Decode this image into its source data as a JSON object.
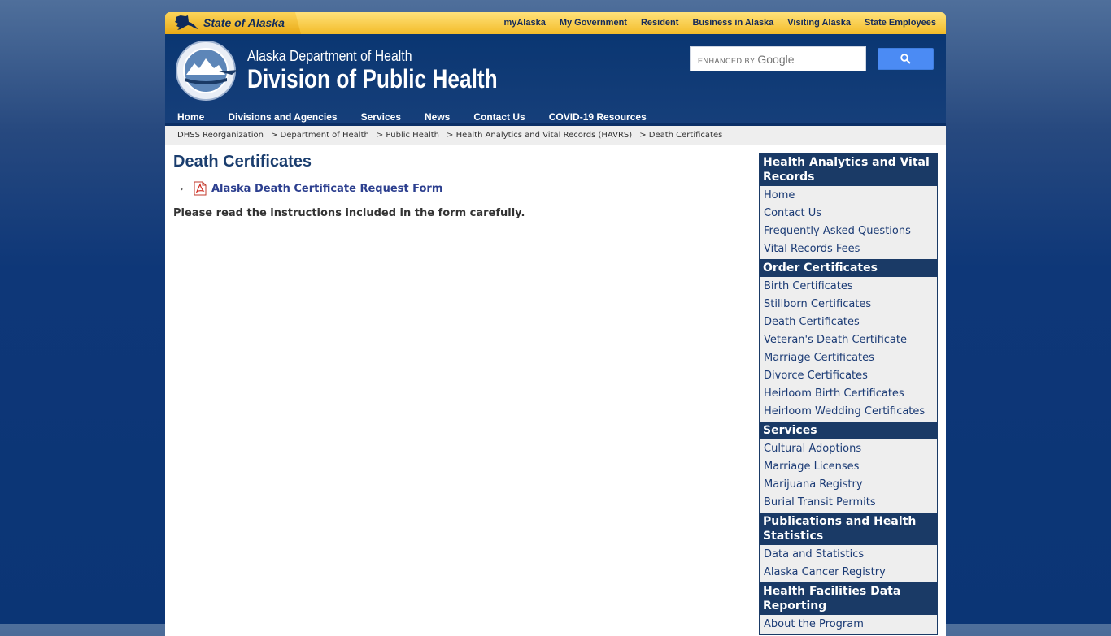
{
  "topbar": {
    "brand": "State of Alaska",
    "links": [
      "myAlaska",
      "My Government",
      "Resident",
      "Business in Alaska",
      "Visiting Alaska",
      "State Employees"
    ]
  },
  "header": {
    "dept": "Alaska Department of Health",
    "division": "Division of Public Health",
    "search_hint_small": "ENHANCED BY",
    "search_hint_brand": "Google"
  },
  "nav": [
    "Home",
    "Divisions and Agencies",
    "Services",
    "News",
    "Contact Us",
    "COVID-19 Resources"
  ],
  "breadcrumb": [
    "DHSS Reorganization",
    "> Department of Health",
    "> Public Health",
    "> Health Analytics and Vital Records (HAVRS)",
    "> Death Certificates"
  ],
  "main": {
    "title": "Death Certificates",
    "link_label": "Alaska Death Certificate Request Form",
    "instructions": "Please read the instructions included in the form carefully."
  },
  "sidebar": [
    {
      "heading": "Health Analytics and Vital Records",
      "items": [
        "Home",
        "Contact Us",
        "Frequently Asked Questions",
        "Vital Records Fees"
      ]
    },
    {
      "heading": "Order Certificates",
      "items": [
        "Birth Certificates",
        "Stillborn Certificates",
        "Death Certificates",
        "Veteran's Death Certificate",
        "Marriage Certificates",
        "Divorce Certificates",
        "Heirloom Birth Certificates",
        "Heirloom Wedding Certificates"
      ]
    },
    {
      "heading": "Services",
      "items": [
        "Cultural Adoptions",
        "Marriage Licenses",
        "Marijuana Registry",
        "Burial Transit Permits"
      ]
    },
    {
      "heading": "Publications and Health Statistics",
      "items": [
        "Data and Statistics",
        "Alaska Cancer Registry"
      ]
    },
    {
      "heading": "Health Facilities Data Reporting",
      "items": [
        "About the Program"
      ]
    }
  ],
  "colors": {
    "accent_yellow": "#f3bc2a",
    "navy": "#0a3672",
    "sidebar_head": "#1a3a66",
    "link": "#2c3f8f"
  }
}
